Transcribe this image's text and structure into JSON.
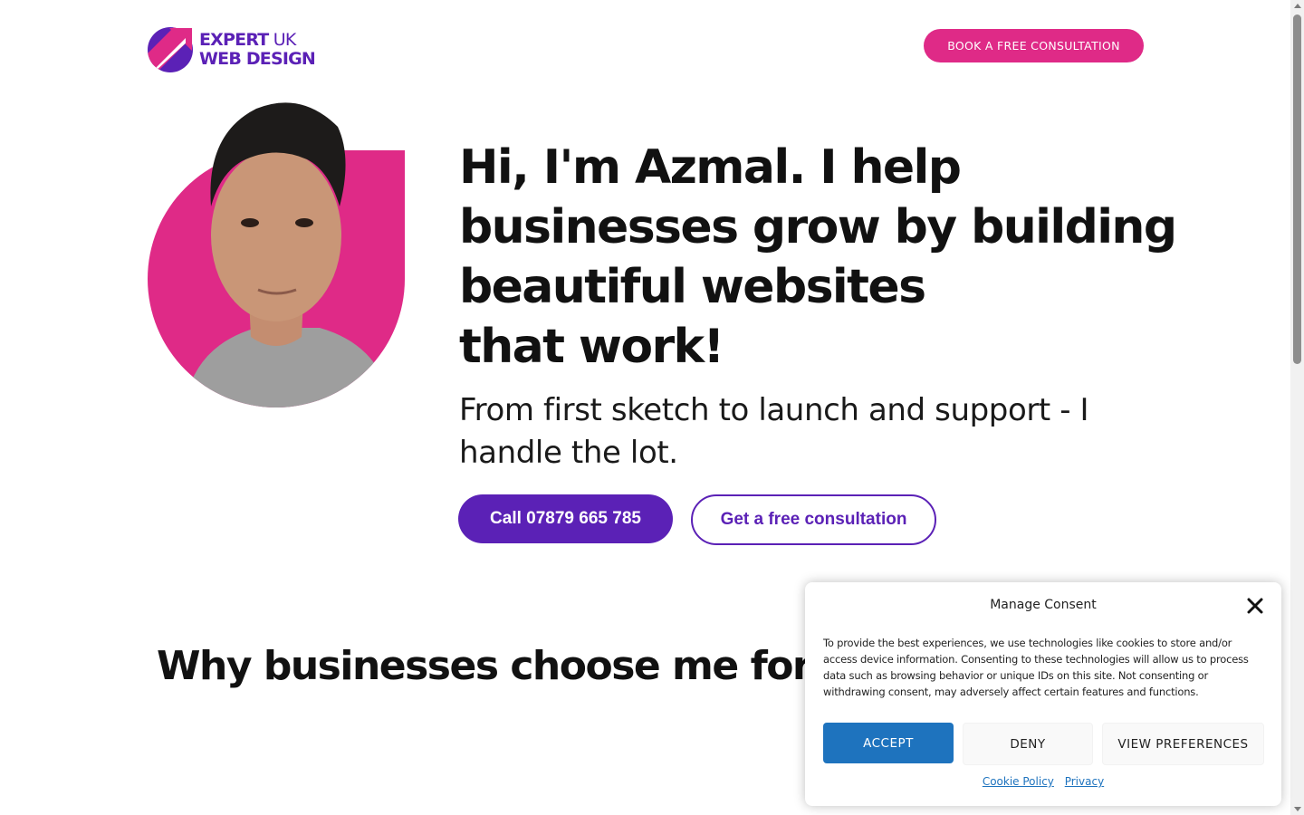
{
  "header": {
    "logo_line1": "EXPERT",
    "logo_line1_suffix": " UK",
    "logo_line2": "WEB DESIGN",
    "cta_label": "BOOK A FREE CONSULTATION"
  },
  "hero": {
    "headline_lines": [
      "Hi, I'm Azmal. I help",
      "businesses grow by building",
      "beautiful websites",
      "that work!"
    ],
    "subheadline": "From first sketch to launch and support - I handle the lot.",
    "call_button_label": "Call 07879 665 785",
    "consult_button_label": "Get a free consultation"
  },
  "section": {
    "title": "Why businesses choose me for th"
  },
  "consent": {
    "title": "Manage Consent",
    "body": "To provide the best experiences, we use technologies like cookies to store and/or access device information. Consenting to these technologies will allow us to process data such as browsing behavior or unique IDs on this site. Not consenting or withdrawing consent, may adversely affect certain features and functions.",
    "accept_label": "ACCEPT",
    "deny_label": "DENY",
    "preferences_label": "VIEW PREFERENCES",
    "cookie_policy_link": "Cookie Policy",
    "privacy_link": "Privacy"
  },
  "colors": {
    "brand_purple": "#5b21b6",
    "brand_pink": "#df2a87",
    "consent_blue": "#1e73be"
  },
  "icons": [
    "logo-arrow-mark",
    "close-icon"
  ]
}
